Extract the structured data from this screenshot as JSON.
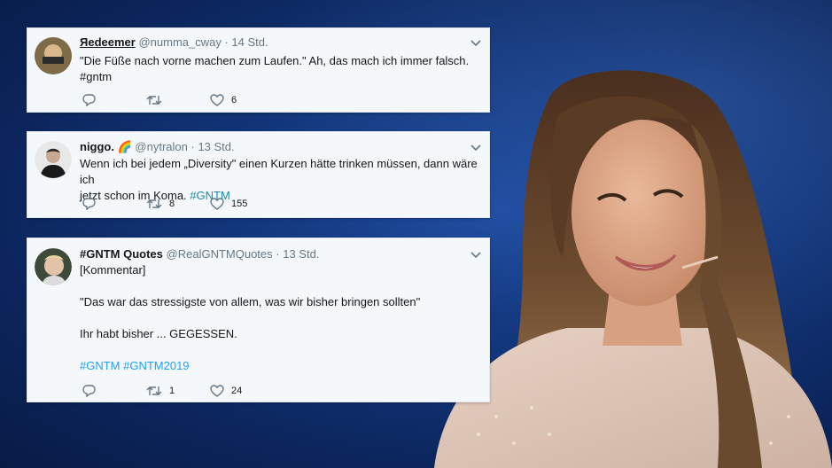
{
  "tweets": [
    {
      "display_name": "Яedeemer",
      "handle": "@numma_cway",
      "time": "· 14 Std.",
      "lines": [
        "\"Die Füße nach vorne machen zum Laufen.\" Ah, das mach ich immer falsch.",
        "#gntm"
      ],
      "retweets": "",
      "likes": "6"
    },
    {
      "display_name": "niggo. 🌈",
      "handle": "@nytralon",
      "time": "· 13 Std.",
      "line1": "Wenn ich bei jedem „Diversity\" einen Kurzen hätte trinken müssen, dann wäre ich",
      "line2_text": "jetzt schon im Koma.",
      "line2_tag": "#GNTM",
      "retweets": "8",
      "likes": "155"
    },
    {
      "display_name": "#GNTM Quotes",
      "handle": "@RealGNTMQuotes",
      "time": "· 13 Std.",
      "lines": [
        "[Kommentar]",
        "\"Das war das stressigste von allem, was wir bisher bringen sollten\"",
        "Ihr habt bisher ... GEGESSEN.",
        "#GNTM #GNTM2019"
      ],
      "retweets": "1",
      "likes": "24"
    }
  ],
  "icons": {
    "reply": "reply-icon",
    "retweet": "retweet-icon",
    "like": "heart-icon",
    "more": "chevron-down-icon"
  },
  "colors": {
    "background": "#123579",
    "card": "#f5f8fa",
    "hashtag": "#1da1f2",
    "meta": "#657786"
  }
}
